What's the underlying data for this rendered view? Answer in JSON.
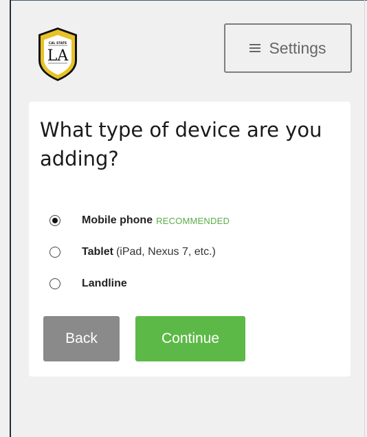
{
  "header": {
    "logo": {
      "top_text": "CAL STATE",
      "monogram": "LA",
      "colors": {
        "gold": "#e8c227",
        "black": "#111111"
      }
    },
    "settings_label": "Settings",
    "settings_icon": "hamburger-icon"
  },
  "card": {
    "question": "What type of device are you adding?",
    "options": [
      {
        "label": "Mobile phone",
        "tag": "RECOMMENDED",
        "detail": "",
        "selected": true
      },
      {
        "label": "Tablet",
        "tag": "",
        "detail": "(iPad, Nexus 7, etc.)",
        "selected": false
      },
      {
        "label": "Landline",
        "tag": "",
        "detail": "",
        "selected": false
      }
    ],
    "back_label": "Back",
    "continue_label": "Continue"
  },
  "colors": {
    "continue": "#5db947",
    "back": "#8a8a8a",
    "recommended": "#5aad47"
  }
}
